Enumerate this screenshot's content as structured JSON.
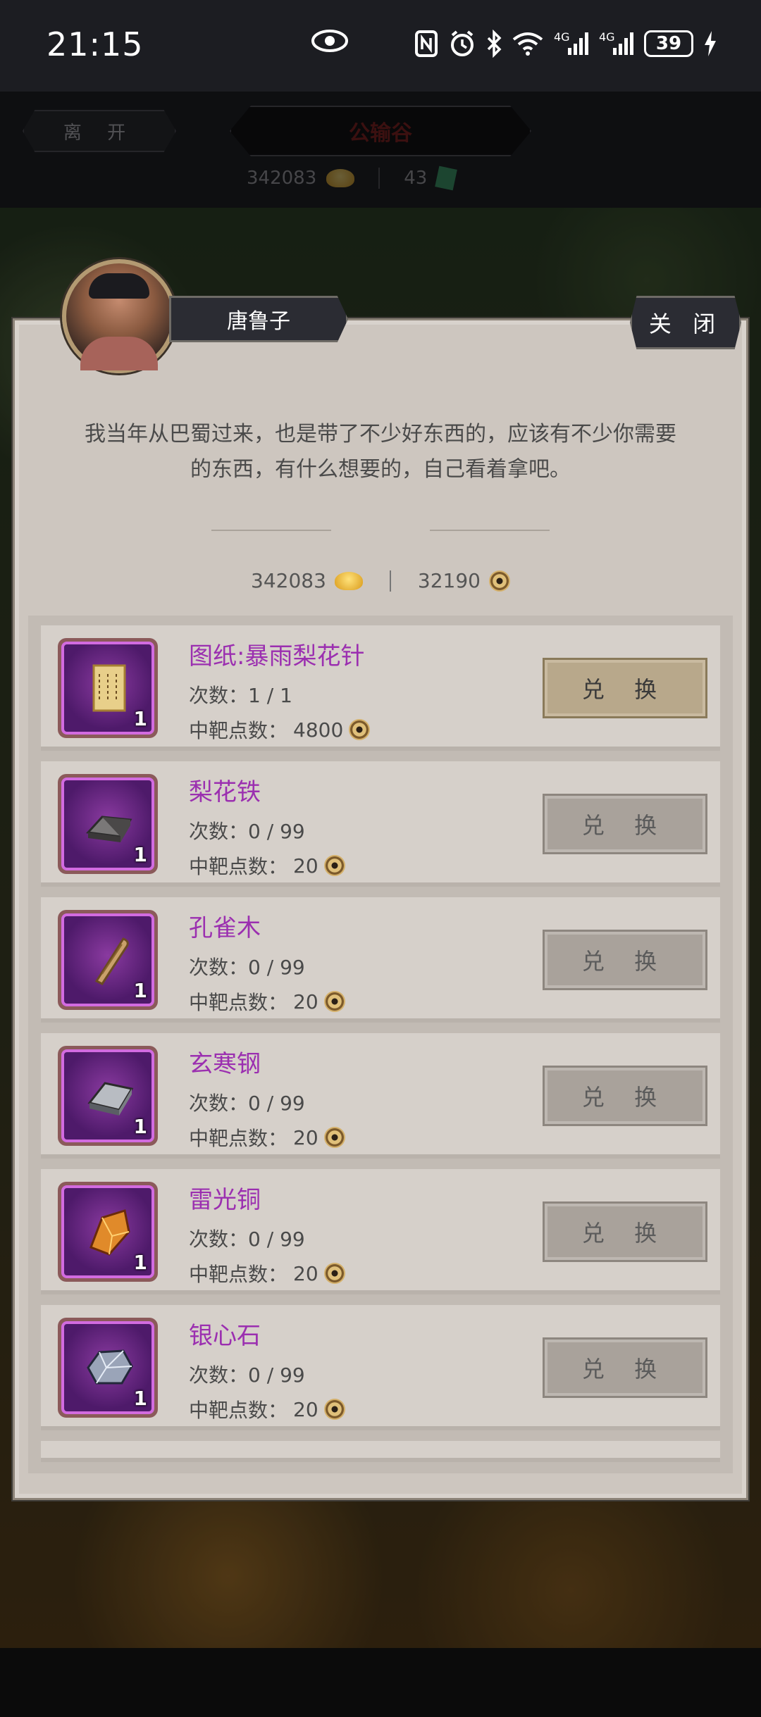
{
  "status_bar": {
    "time": "21:15",
    "battery": "39",
    "icons": [
      "eye-icon",
      "nfc-icon",
      "alarm-icon",
      "bluetooth-icon",
      "wifi-icon",
      "signal-4g-icon",
      "signal-4g-icon",
      "battery-icon",
      "charging-icon"
    ]
  },
  "game_header": {
    "leave_label": "离 开",
    "title": "公输谷",
    "gold": "342083",
    "jade": "43"
  },
  "dialog": {
    "npc_name": "唐鲁子",
    "close_label": "关 闭",
    "text_line1": "我当年从巴蜀过来，也是带了不少好东西的，应该有不少你需要",
    "text_line2": "的东西，有什么想要的，自己看着拿吧。"
  },
  "currency": {
    "gold": "342083",
    "target_points": "32190"
  },
  "shop": {
    "times_prefix": "次数：",
    "cost_prefix": "中靶点数：",
    "exchange_label": "兑 换",
    "items": [
      {
        "name": "图纸:暴雨梨花针",
        "times": "1 / 1",
        "cost": "4800",
        "count": "1",
        "icon": "blueprint-scroll-icon",
        "active": true
      },
      {
        "name": "梨花铁",
        "times": "0 / 99",
        "cost": "20",
        "count": "1",
        "icon": "iron-ingot-icon",
        "active": false
      },
      {
        "name": "孔雀木",
        "times": "0 / 99",
        "cost": "20",
        "count": "1",
        "icon": "peacock-wood-icon",
        "active": false
      },
      {
        "name": "玄寒钢",
        "times": "0 / 99",
        "cost": "20",
        "count": "1",
        "icon": "steel-ingot-icon",
        "active": false
      },
      {
        "name": "雷光铜",
        "times": "0 / 99",
        "cost": "20",
        "count": "1",
        "icon": "copper-ore-icon",
        "active": false
      },
      {
        "name": "银心石",
        "times": "0 / 99",
        "cost": "20",
        "count": "1",
        "icon": "silver-stone-icon",
        "active": false
      }
    ]
  }
}
